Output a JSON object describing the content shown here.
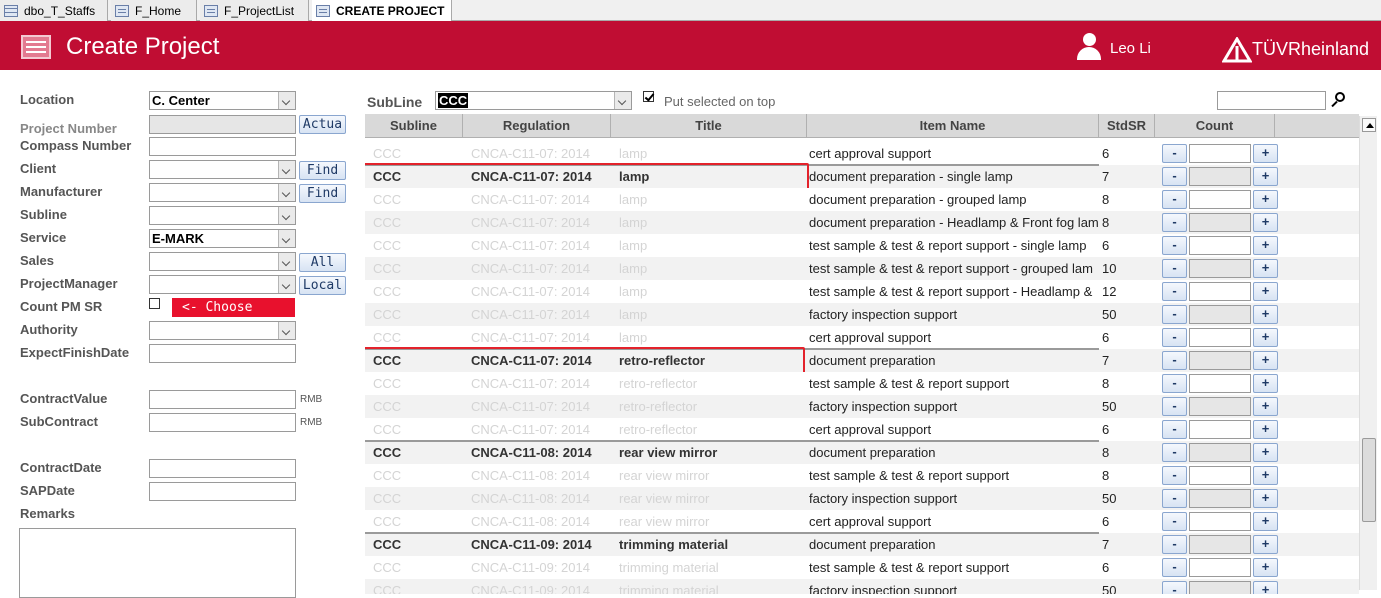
{
  "tabs": [
    {
      "label": "dbo_T_Staffs",
      "icon": "table-icon"
    },
    {
      "label": "F_Home",
      "icon": "form-icon"
    },
    {
      "label": "F_ProjectList",
      "icon": "form-icon"
    },
    {
      "label": "CREATE PROJECT",
      "icon": "form-icon",
      "active": true
    }
  ],
  "header": {
    "title": "Create Project",
    "user": "Leo Li",
    "brand": "TÜVRheinland",
    "color": "#c00d33"
  },
  "form": {
    "location": {
      "label": "Location",
      "value": "C. Center"
    },
    "project_number": {
      "label": "Project Number",
      "button": "Actua"
    },
    "compass_number": {
      "label": "Compass Number"
    },
    "client": {
      "label": "Client",
      "button": "Find"
    },
    "manufacturer": {
      "label": "Manufacturer",
      "button": "Find"
    },
    "subline": {
      "label": "Subline"
    },
    "service": {
      "label": "Service",
      "value": "E-MARK"
    },
    "sales": {
      "label": "Sales",
      "button": "All"
    },
    "project_manager": {
      "label": "ProjectManager",
      "button": "Local"
    },
    "count_pm_sr": {
      "label": "Count PM SR",
      "choose": "<- Choose"
    },
    "authority": {
      "label": "Authority"
    },
    "expect_finish_date": {
      "label": "ExpectFinishDate"
    },
    "contract_value": {
      "label": "ContractValue",
      "unit": "RMB"
    },
    "sub_contract": {
      "label": "SubContract",
      "unit": "RMB"
    },
    "contract_date": {
      "label": "ContractDate"
    },
    "sap_date": {
      "label": "SAPDate"
    },
    "remarks": {
      "label": "Remarks"
    }
  },
  "filter": {
    "subline_label": "SubLine",
    "subline_value": "CCC",
    "put_selected_label": "Put selected on top",
    "put_selected_checked": true
  },
  "grid": {
    "columns": [
      "Subline",
      "Regulation",
      "Title",
      "Item Name",
      "StdSR",
      "Count"
    ],
    "minus_label": "-",
    "plus_label": "+",
    "rows": [
      {
        "subline": "CCC",
        "regulation": "CNCA-C11-07: 2014",
        "title": "lamp",
        "item": "cert approval support",
        "std": "6",
        "ghost": true
      },
      {
        "subline": "CCC",
        "regulation": "CNCA-C11-07: 2014",
        "title": "lamp",
        "item": "document preparation - single lamp",
        "std": "7",
        "ghost": false,
        "group_start": true,
        "highlight": true
      },
      {
        "subline": "CCC",
        "regulation": "CNCA-C11-07: 2014",
        "title": "lamp",
        "item": "document preparation - grouped lamp",
        "std": "8",
        "ghost": true
      },
      {
        "subline": "CCC",
        "regulation": "CNCA-C11-07: 2014",
        "title": "lamp",
        "item": "document preparation - Headlamp & Front fog lam",
        "std": "8",
        "ghost": true
      },
      {
        "subline": "CCC",
        "regulation": "CNCA-C11-07: 2014",
        "title": "lamp",
        "item": "test sample & test & report support - single lamp",
        "std": "6",
        "ghost": true
      },
      {
        "subline": "CCC",
        "regulation": "CNCA-C11-07: 2014",
        "title": "lamp",
        "item": "test sample & test & report support - grouped lam",
        "std": "10",
        "ghost": true
      },
      {
        "subline": "CCC",
        "regulation": "CNCA-C11-07: 2014",
        "title": "lamp",
        "item": "test sample & test & report support - Headlamp &",
        "std": "12",
        "ghost": true
      },
      {
        "subline": "CCC",
        "regulation": "CNCA-C11-07: 2014",
        "title": "lamp",
        "item": "factory inspection support",
        "std": "50",
        "ghost": true
      },
      {
        "subline": "CCC",
        "regulation": "CNCA-C11-07: 2014",
        "title": "lamp",
        "item": "cert approval support",
        "std": "6",
        "ghost": true
      },
      {
        "subline": "CCC",
        "regulation": "CNCA-C11-07: 2014",
        "title": "retro-reflector",
        "item": "document preparation",
        "std": "7",
        "ghost": false,
        "group_start": true,
        "highlight": true
      },
      {
        "subline": "CCC",
        "regulation": "CNCA-C11-07: 2014",
        "title": "retro-reflector",
        "item": "test sample & test & report support",
        "std": "8",
        "ghost": true
      },
      {
        "subline": "CCC",
        "regulation": "CNCA-C11-07: 2014",
        "title": "retro-reflector",
        "item": "factory inspection support",
        "std": "50",
        "ghost": true
      },
      {
        "subline": "CCC",
        "regulation": "CNCA-C11-07: 2014",
        "title": "retro-reflector",
        "item": "cert approval support",
        "std": "6",
        "ghost": true
      },
      {
        "subline": "CCC",
        "regulation": "CNCA-C11-08: 2014",
        "title": "rear view mirror",
        "item": "document preparation",
        "std": "8",
        "ghost": false,
        "group_start": true
      },
      {
        "subline": "CCC",
        "regulation": "CNCA-C11-08: 2014",
        "title": "rear view mirror",
        "item": "test sample & test & report support",
        "std": "8",
        "ghost": true
      },
      {
        "subline": "CCC",
        "regulation": "CNCA-C11-08: 2014",
        "title": "rear view mirror",
        "item": "factory inspection support",
        "std": "50",
        "ghost": true
      },
      {
        "subline": "CCC",
        "regulation": "CNCA-C11-08: 2014",
        "title": "rear view mirror",
        "item": "cert approval support",
        "std": "6",
        "ghost": true
      },
      {
        "subline": "CCC",
        "regulation": "CNCA-C11-09: 2014",
        "title": "trimming material",
        "item": "document preparation",
        "std": "7",
        "ghost": false,
        "group_start": true
      },
      {
        "subline": "CCC",
        "regulation": "CNCA-C11-09: 2014",
        "title": "trimming material",
        "item": "test sample & test & report support",
        "std": "6",
        "ghost": true
      },
      {
        "subline": "CCC",
        "regulation": "CNCA-C11-09: 2014",
        "title": "trimming material",
        "item": "factory inspection support",
        "std": "50",
        "ghost": true
      }
    ]
  }
}
